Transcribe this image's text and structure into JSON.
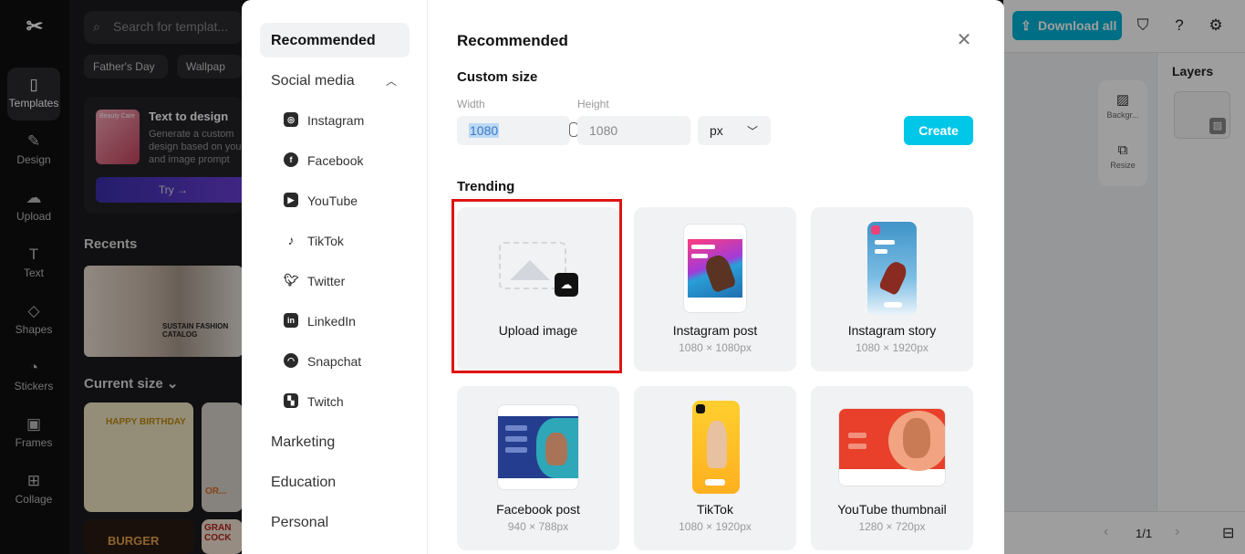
{
  "app": {
    "rail": [
      {
        "label": "Templates",
        "icon": "templates-icon"
      },
      {
        "label": "Design",
        "icon": "design-icon"
      },
      {
        "label": "Upload",
        "icon": "upload-icon"
      },
      {
        "label": "Text",
        "icon": "text-icon"
      },
      {
        "label": "Shapes",
        "icon": "shapes-icon"
      },
      {
        "label": "Stickers",
        "icon": "stickers-icon"
      },
      {
        "label": "Frames",
        "icon": "frames-icon"
      },
      {
        "label": "Collage",
        "icon": "collage-icon"
      }
    ],
    "search_placeholder": "Search for templat...",
    "chips": [
      "Father's Day",
      "Wallpap"
    ],
    "text_to_design": {
      "thumb_label": "Beauty Care",
      "title": "Text to design",
      "description": "Generate a custom design based on your and image prompt",
      "try_label": "Try →"
    },
    "recents_title": "Recents",
    "recent_caption": "SUSTAIN FASHION CATALOG",
    "current_size_title": "Current size",
    "template_texts": [
      "HAPPY BIRTHDAY",
      "OR...",
      "BURGER",
      "GRAN COCK"
    ],
    "download_label": "Download all",
    "tools": [
      "Backgr...",
      "Resize"
    ],
    "layers_title": "Layers",
    "pager": "1/1",
    "colors": {
      "accent": "#00c6e8",
      "download": "#00b2d6",
      "highlight": "#e01414"
    }
  },
  "modal": {
    "nav": {
      "recommended": "Recommended",
      "social_media": "Social media",
      "social_items": [
        {
          "label": "Instagram",
          "icon": "instagram-icon"
        },
        {
          "label": "Facebook",
          "icon": "facebook-icon"
        },
        {
          "label": "YouTube",
          "icon": "youtube-icon"
        },
        {
          "label": "TikTok",
          "icon": "tiktok-icon"
        },
        {
          "label": "Twitter",
          "icon": "twitter-icon"
        },
        {
          "label": "LinkedIn",
          "icon": "linkedin-icon"
        },
        {
          "label": "Snapchat",
          "icon": "snapchat-icon"
        },
        {
          "label": "Twitch",
          "icon": "twitch-icon"
        }
      ],
      "marketing": "Marketing",
      "education": "Education",
      "personal": "Personal"
    },
    "title": "Recommended",
    "custom_size": {
      "title": "Custom size",
      "width_label": "Width",
      "width_value": "1080",
      "height_label": "Height",
      "height_value": "1080",
      "unit": "px",
      "create_label": "Create"
    },
    "trending": {
      "title": "Trending",
      "cards": [
        {
          "name": "Upload image",
          "size": ""
        },
        {
          "name": "Instagram post",
          "size": "1080 × 1080px"
        },
        {
          "name": "Instagram story",
          "size": "1080 × 1920px"
        },
        {
          "name": "Facebook post",
          "size": "940 × 788px"
        },
        {
          "name": "TikTok",
          "size": "1080 × 1920px"
        },
        {
          "name": "YouTube thumbnail",
          "size": "1280 × 720px"
        }
      ]
    }
  }
}
